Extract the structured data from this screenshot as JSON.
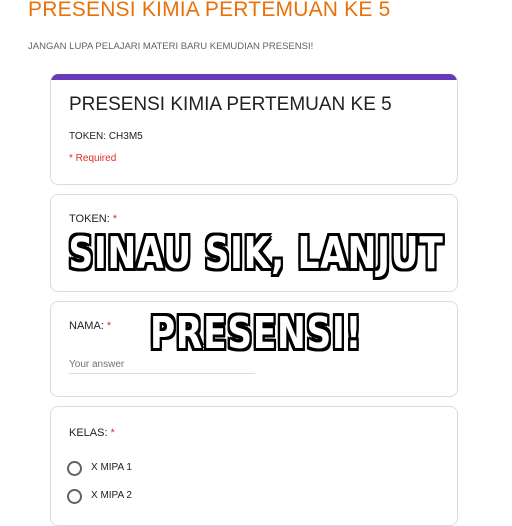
{
  "page": {
    "title": "PRESENSI KIMIA PERTEMUAN KE 5",
    "subtitle": "JANGAN LUPA PELAJARI MATERI BARU KEMUDIAN PRESENSI!"
  },
  "colors": {
    "page_title": "#e8710a",
    "form_accent": "#673ab7",
    "required": "#d93025"
  },
  "form": {
    "title": "PRESENSI KIMIA PERTEMUAN KE 5",
    "token_note": "TOKEN: CH3M5",
    "required_note": "* Required"
  },
  "questions": {
    "token": {
      "label": "TOKEN:",
      "required_mark": "*"
    },
    "nama": {
      "label": "NAMA:",
      "required_mark": "*",
      "placeholder": "Your answer"
    },
    "kelas": {
      "label": "KELAS:",
      "required_mark": "*",
      "options": [
        "X MIPA 1",
        "X MIPA 2"
      ]
    }
  },
  "overlay": {
    "line1": "SINAU SIK, LANJUT",
    "line2": "PRESENSI!"
  }
}
